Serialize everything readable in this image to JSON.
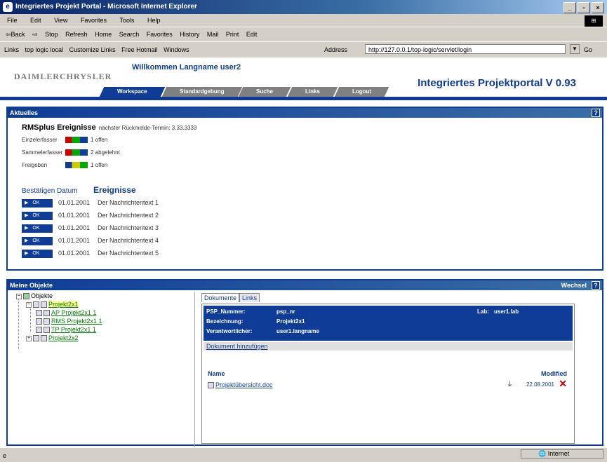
{
  "window": {
    "title": "Integriertes Projekt Portal - Microsoft Internet Explorer",
    "ie_icon": "ie-logo-icon",
    "buttons": [
      "_",
      "▫",
      "×"
    ]
  },
  "menu": [
    "File",
    "Edit",
    "View",
    "Favorites",
    "Tools",
    "Help"
  ],
  "toolbar": [
    "⇦Back",
    "⇨",
    "Stop",
    "Refresh",
    "Home",
    "Search",
    "Favorites",
    "History",
    "Mail",
    "Print",
    "Edit"
  ],
  "links": {
    "label": "Links",
    "items": [
      "top logic local",
      "Customize Links",
      "Free Hotmail",
      "Windows"
    ]
  },
  "address": {
    "label": "Address",
    "value": "http://127.0.0.1/top-logic/servlet/login",
    "go": "Go"
  },
  "header": {
    "logo": "DAIMLERCHRYSLER",
    "welcome": "Willkommen Langname user2",
    "portal": "Integriertes Projektportal V 0.93",
    "tabs": [
      "Workspace",
      "Standardgebung",
      "Suche",
      "Links",
      "Logout"
    ]
  },
  "aktuelles": {
    "title": "Aktuelles",
    "help": "?",
    "rms_title": "RMSplus Ereignisse",
    "rms_next": "nächster Rückmelde-Termin: 3.33.3333",
    "statuses": [
      {
        "label": "Einzelerfasser",
        "value": "1 offen"
      },
      {
        "label": "Sammelerfasser",
        "value": "2 abgelehnt"
      },
      {
        "label": "Freigeben",
        "value": "1 offen"
      }
    ],
    "col_date": "Bestätigen Datum",
    "col_events": "Ereignisse",
    "ok_label": "OK",
    "events": [
      {
        "date": "01.01.2001",
        "text": "Der Nachrichtentext 1"
      },
      {
        "date": "01.01.2001",
        "text": "Der Nachrichtentext 2"
      },
      {
        "date": "01.01.2001",
        "text": "Der Nachrichtentext 3"
      },
      {
        "date": "01.01.2001",
        "text": "Der Nachrichtentext 4"
      },
      {
        "date": "01.01.2001",
        "text": "Der Nachrichtentext 5"
      }
    ]
  },
  "objects": {
    "title": "Meine Objekte",
    "wechsel": "Wechsel",
    "help": "?",
    "tree": {
      "root": "Objekte",
      "project1": "Projekt2x1",
      "children": [
        "AP Projekt2x1 1",
        "RMS Projekt2x1 1",
        "TP Projekt2x1 1"
      ],
      "project2": "Projekt2x2"
    },
    "tabs": [
      "Dokumente",
      "Links"
    ],
    "info": {
      "psp_label": "PSP_Nummer:",
      "psp_value": "psp_nr",
      "bez_label": "Bezeichnung:",
      "bez_value": "Projekt2x1",
      "ver_label": "Verantwortlicher:",
      "ver_value": "user1.langname",
      "lab_label": "Lab:",
      "lab_value": "user1.lab"
    },
    "doc_edit": "Dokument hinzufügen",
    "col_name": "Name",
    "col_modified": "Modified",
    "doc_name": "Projektübersicht.doc",
    "doc_date": "22.08.2001"
  },
  "statusbar": {
    "page_icon": "e",
    "zone": "Internet"
  }
}
